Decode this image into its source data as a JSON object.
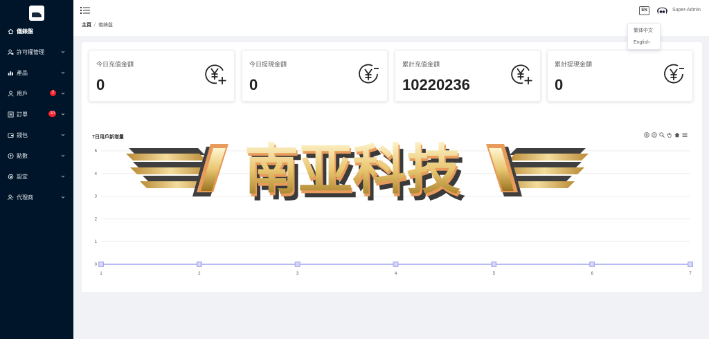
{
  "sidebar": {
    "items": [
      {
        "label": "儀錶盤",
        "icon": "home-icon",
        "badge": ""
      },
      {
        "label": "許可權管理",
        "icon": "user-lock-icon",
        "badge": ""
      },
      {
        "label": "產品",
        "icon": "bar-chart-icon",
        "badge": ""
      },
      {
        "label": "用戶",
        "icon": "user-icon",
        "badge": "2"
      },
      {
        "label": "訂單",
        "icon": "list-icon",
        "badge": "10"
      },
      {
        "label": "錢包",
        "icon": "wallet-icon",
        "badge": ""
      },
      {
        "label": "點數",
        "icon": "points-icon",
        "badge": ""
      },
      {
        "label": "設定",
        "icon": "settings-icon",
        "badge": ""
      },
      {
        "label": "代理商",
        "icon": "agent-icon",
        "badge": ""
      }
    ]
  },
  "header": {
    "breadcrumb_home": "主頁",
    "breadcrumb_sep": "/",
    "breadcrumb_current": "儀錶盤",
    "lang_button": "EN",
    "user_name": "Super-Admin",
    "lang_options": [
      "繁体中文",
      "English"
    ]
  },
  "stats": [
    {
      "title": "今日充值金額",
      "value": "0",
      "icon": "yen-plus-icon"
    },
    {
      "title": "今日提現金額",
      "value": "0",
      "icon": "yen-minus-icon"
    },
    {
      "title": "累計充值金額",
      "value": "10220236",
      "icon": "yen-plus-icon"
    },
    {
      "title": "累計提現金額",
      "value": "0",
      "icon": "yen-minus-icon"
    }
  ],
  "watermark": {
    "text": "南亚科技"
  },
  "chart_data": {
    "type": "line",
    "title": "7日用戶新增量",
    "xlabel": "",
    "ylabel": "",
    "categories": [
      "1",
      "2",
      "3",
      "4",
      "5",
      "6",
      "7"
    ],
    "yticks": [
      "0",
      "1",
      "2",
      "3",
      "4",
      "5"
    ],
    "ylim": [
      0,
      5
    ],
    "grid": true,
    "series": [
      {
        "values": [
          0,
          0,
          0,
          0,
          0,
          0,
          0
        ],
        "color": "#a3a3f0"
      }
    ]
  },
  "colors": {
    "sidebar_bg": "#001529",
    "badge": "#f5222d",
    "series": "#a3a3f0"
  }
}
